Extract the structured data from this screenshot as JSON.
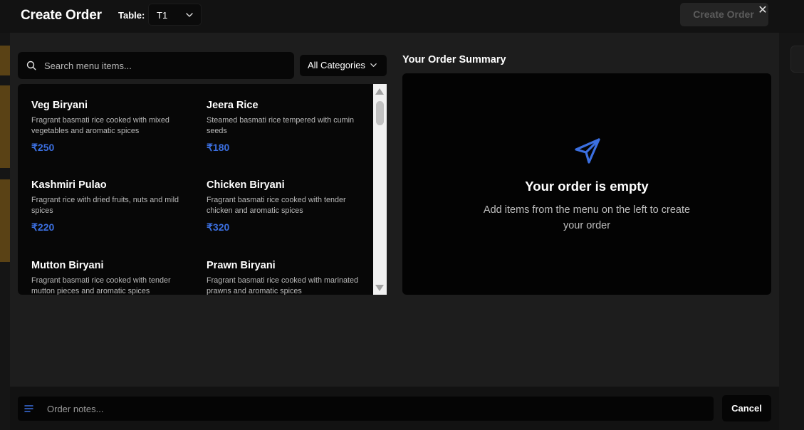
{
  "header": {
    "title": "Create Order",
    "table_label": "Table:",
    "table_value": "T1",
    "create_button": "Create Order",
    "close_glyph": "✕"
  },
  "search": {
    "placeholder": "Search menu items..."
  },
  "category": {
    "selected": "All Categories"
  },
  "menu_items": [
    {
      "name": "Veg Biryani",
      "description": "Fragrant basmati rice cooked with mixed vegetables and aromatic spices",
      "price": "₹250"
    },
    {
      "name": "Jeera Rice",
      "description": "Steamed basmati rice tempered with cumin seeds",
      "price": "₹180"
    },
    {
      "name": "Kashmiri Pulao",
      "description": "Fragrant rice with dried fruits, nuts and mild spices",
      "price": "₹220"
    },
    {
      "name": "Chicken Biryani",
      "description": "Fragrant basmati rice cooked with tender chicken and aromatic spices",
      "price": "₹320"
    },
    {
      "name": "Mutton Biryani",
      "description": "Fragrant basmati rice cooked with tender mutton pieces and aromatic spices",
      "price": ""
    },
    {
      "name": "Prawn Biryani",
      "description": "Fragrant basmati rice cooked with marinated prawns and aromatic spices",
      "price": ""
    }
  ],
  "summary": {
    "title": "Your Order Summary",
    "empty_title": "Your order is empty",
    "empty_hint": "Add items from the menu on the left to create your order",
    "icon": "send-icon"
  },
  "footer": {
    "notes_placeholder": "Order notes...",
    "cancel_label": "Cancel"
  },
  "colors": {
    "accent": "#3b6fe0",
    "panel": "#070707",
    "modal": "#1d1d1d"
  }
}
